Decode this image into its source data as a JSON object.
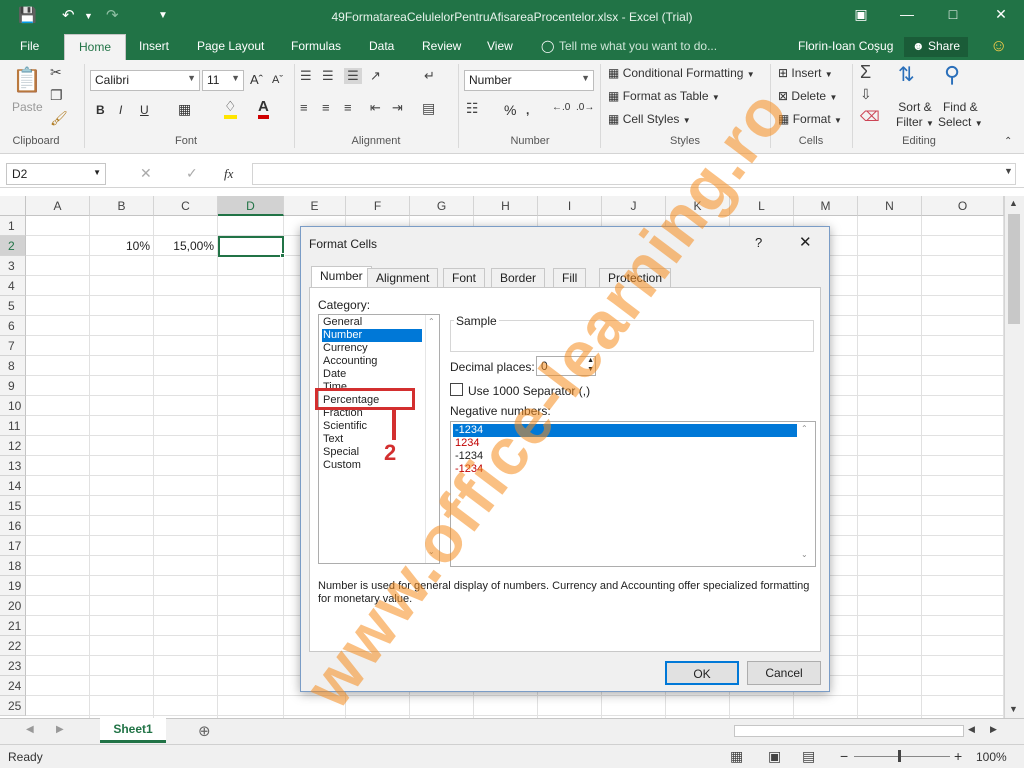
{
  "app": {
    "title": "49FormatareaCelulelorPentruAfisareaProcentelor.xlsx - Excel (Trial)",
    "user": "Florin-Ioan Coşug",
    "share": "Share",
    "tell_me": "Tell me what you want to do..."
  },
  "ribbon_tabs": [
    "File",
    "Home",
    "Insert",
    "Page Layout",
    "Formulas",
    "Data",
    "Review",
    "View"
  ],
  "ribbon": {
    "clipboard": {
      "label": "Clipboard",
      "paste": "Paste"
    },
    "font": {
      "label": "Font",
      "name": "Calibri",
      "size": "11",
      "bold": "B",
      "italic": "I",
      "underline": "U"
    },
    "alignment": {
      "label": "Alignment"
    },
    "number": {
      "label": "Number",
      "format": "Number",
      "percent": "%"
    },
    "styles": {
      "label": "Styles",
      "conditional": "Conditional Formatting",
      "format_table": "Format as Table",
      "cell_styles": "Cell Styles"
    },
    "cells": {
      "label": "Cells",
      "insert": "Insert",
      "delete": "Delete",
      "format": "Format"
    },
    "editing": {
      "label": "Editing",
      "sort": "Sort &",
      "filter": "Filter",
      "find": "Find &",
      "select": "Select"
    }
  },
  "formula_bar": {
    "name_box": "D2",
    "fx": "fx"
  },
  "grid": {
    "columns": [
      "A",
      "B",
      "C",
      "D",
      "E",
      "F",
      "G",
      "H",
      "I",
      "J",
      "K",
      "L",
      "M",
      "N",
      "O"
    ],
    "rows": [
      "1",
      "2",
      "3",
      "4",
      "5",
      "6",
      "7",
      "8",
      "9",
      "10",
      "11",
      "12",
      "13",
      "14",
      "15",
      "16",
      "17",
      "18",
      "19",
      "20",
      "21",
      "22",
      "23",
      "24",
      "25"
    ],
    "cells": {
      "B2": "10%",
      "C2": "15,00%"
    }
  },
  "sheets": {
    "active": "Sheet1"
  },
  "status": {
    "left": "Ready",
    "zoom": "100%"
  },
  "dialog": {
    "title": "Format Cells",
    "help": "?",
    "tabs": [
      "Number",
      "Alignment",
      "Font",
      "Border",
      "Fill",
      "Protection"
    ],
    "category_label": "Category:",
    "categories": [
      "General",
      "Number",
      "Currency",
      "Accounting",
      "Date",
      "Time",
      "Percentage",
      "Fraction",
      "Scientific",
      "Text",
      "Special",
      "Custom"
    ],
    "selected_category": "Number",
    "sample_label": "Sample",
    "decimal_label": "Decimal places:",
    "decimal_value": "0",
    "separator_label": "Use 1000 Separator (,)",
    "negative_label": "Negative numbers:",
    "negatives": [
      "-1234",
      "1234",
      "-1234",
      "-1234"
    ],
    "description": "Number is used for general display of numbers.  Currency and Accounting offer specialized formatting for monetary value.",
    "ok": "OK",
    "cancel": "Cancel",
    "callout_label": "Percentage",
    "callout_number": "2"
  },
  "watermark": "www.office-learning.ro",
  "colors": {
    "excel_green": "#217346",
    "selection_blue": "#0078d7",
    "callout_red": "#d32f2f",
    "negative_red": "#c00000",
    "watermark": "#f58c1e"
  }
}
